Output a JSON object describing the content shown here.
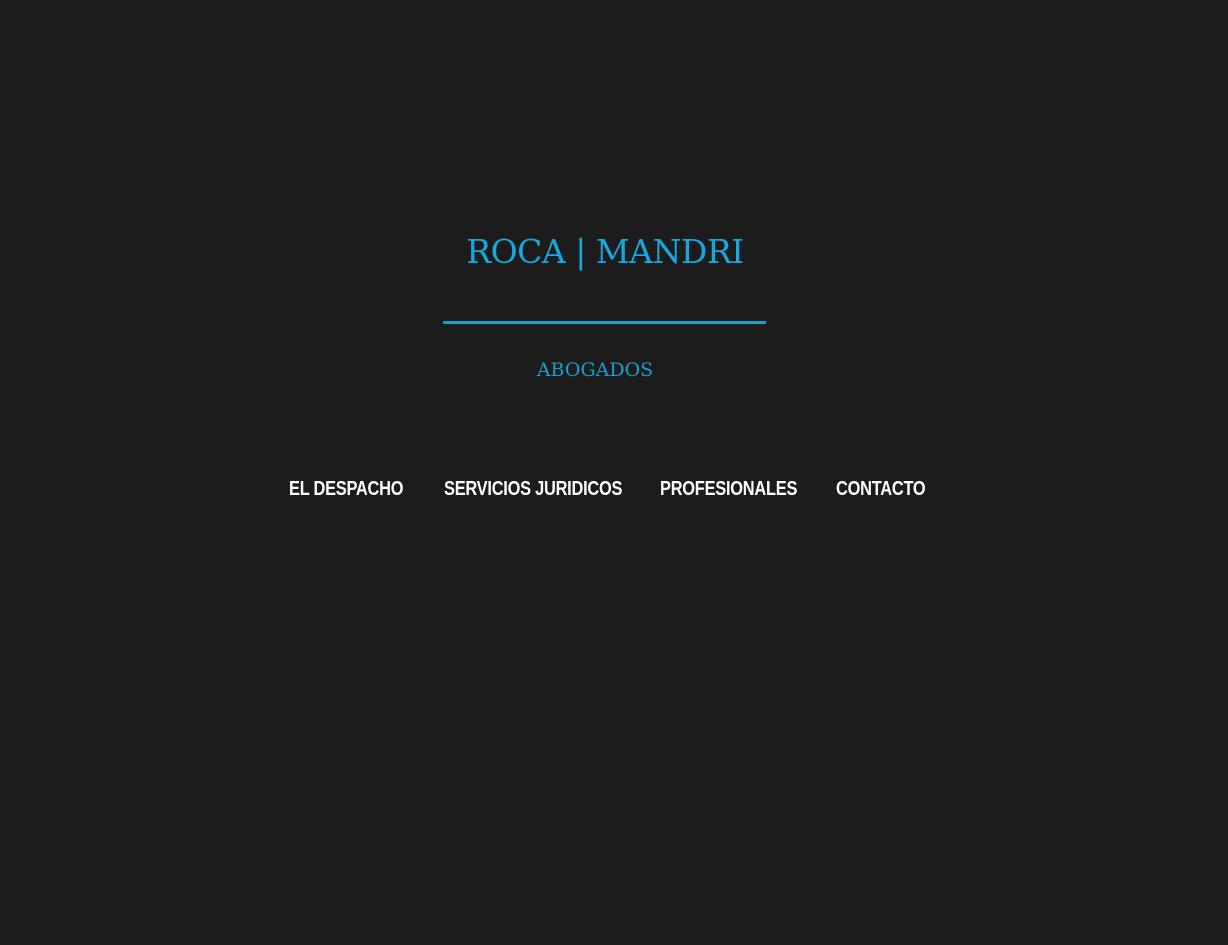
{
  "brand": {
    "title": "ROCA | MANDRI",
    "subtitle": "ABOGADOS",
    "accent": "#17a8e0"
  },
  "nav": {
    "items": [
      {
        "label": "EL DESPACHO"
      },
      {
        "label": "SERVICIOS JURIDICOS"
      },
      {
        "label": "PROFESIONALES"
      },
      {
        "label": "CONTACTO"
      }
    ]
  }
}
